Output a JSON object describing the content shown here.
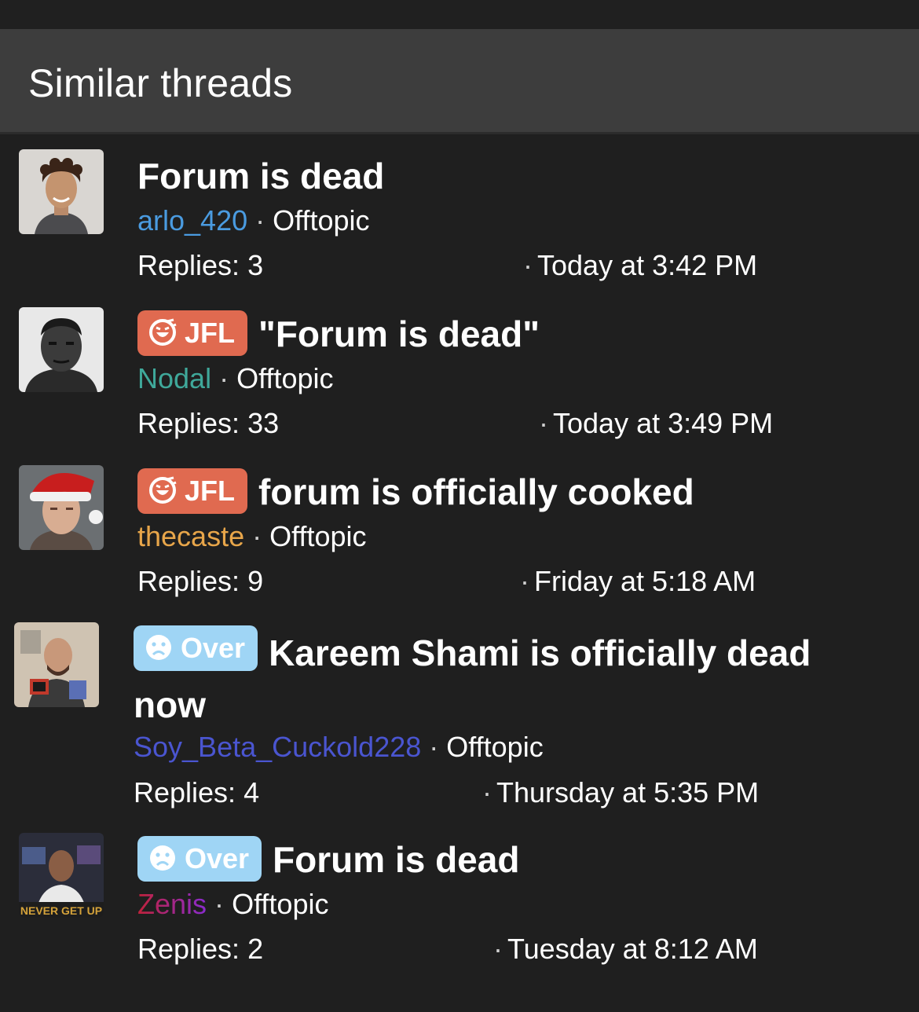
{
  "header": {
    "title": "Similar threads"
  },
  "colors": {
    "background": "#1f1f1f",
    "header_bg": "#3d3d3d",
    "label_jfl": "#e06a50",
    "label_over": "#9fd5f5",
    "user_arlo": "#4a9be0",
    "user_nodal": "#3fa89a",
    "user_thecaste": "#e8a64a",
    "user_soy": "#4a55d0",
    "user_zenis": "#c0223a"
  },
  "threads": [
    {
      "title": "Forum is dead",
      "label": "",
      "author": "arlo_420",
      "separator": "·",
      "forum": "Offtopic",
      "replies": "Replies: 3",
      "date_sep": "·",
      "date": "Today at 3:42 PM",
      "avatar_icon": "user-avatar-photo"
    },
    {
      "title": "\"Forum is dead\"",
      "label": "JFL",
      "label_icon": "laughing-face-icon",
      "author": "Nodal",
      "separator": "·",
      "forum": "Offtopic",
      "replies": "Replies: 33",
      "date_sep": "·",
      "date": "Today at 3:49 PM",
      "avatar_icon": "user-avatar-photo"
    },
    {
      "title": "forum is officially cooked",
      "label": "JFL",
      "label_icon": "laughing-face-icon",
      "author": "thecaste",
      "separator": "·",
      "forum": "Offtopic",
      "replies": "Replies: 9",
      "date_sep": "·",
      "date": "Friday at 5:18 AM",
      "avatar_icon": "user-avatar-photo"
    },
    {
      "title": "Kareem Shami is officially dead now",
      "label": "Over",
      "label_icon": "sad-face-icon",
      "author": "Soy_Beta_Cuckold228",
      "separator": "·",
      "forum": "Offtopic",
      "replies": "Replies: 4",
      "date_sep": "·",
      "date": "Thursday at 5:35 PM",
      "avatar_icon": "user-avatar-photo"
    },
    {
      "title": "Forum is dead",
      "label": "Over",
      "label_icon": "sad-face-icon",
      "author": "Zenis",
      "separator": "·",
      "forum": "Offtopic",
      "replies": "Replies: 2",
      "date_sep": "·",
      "date": "Tuesday at 8:12 AM",
      "avatar_icon": "user-avatar-photo",
      "avatar_text": "NEVER GET UP"
    }
  ]
}
